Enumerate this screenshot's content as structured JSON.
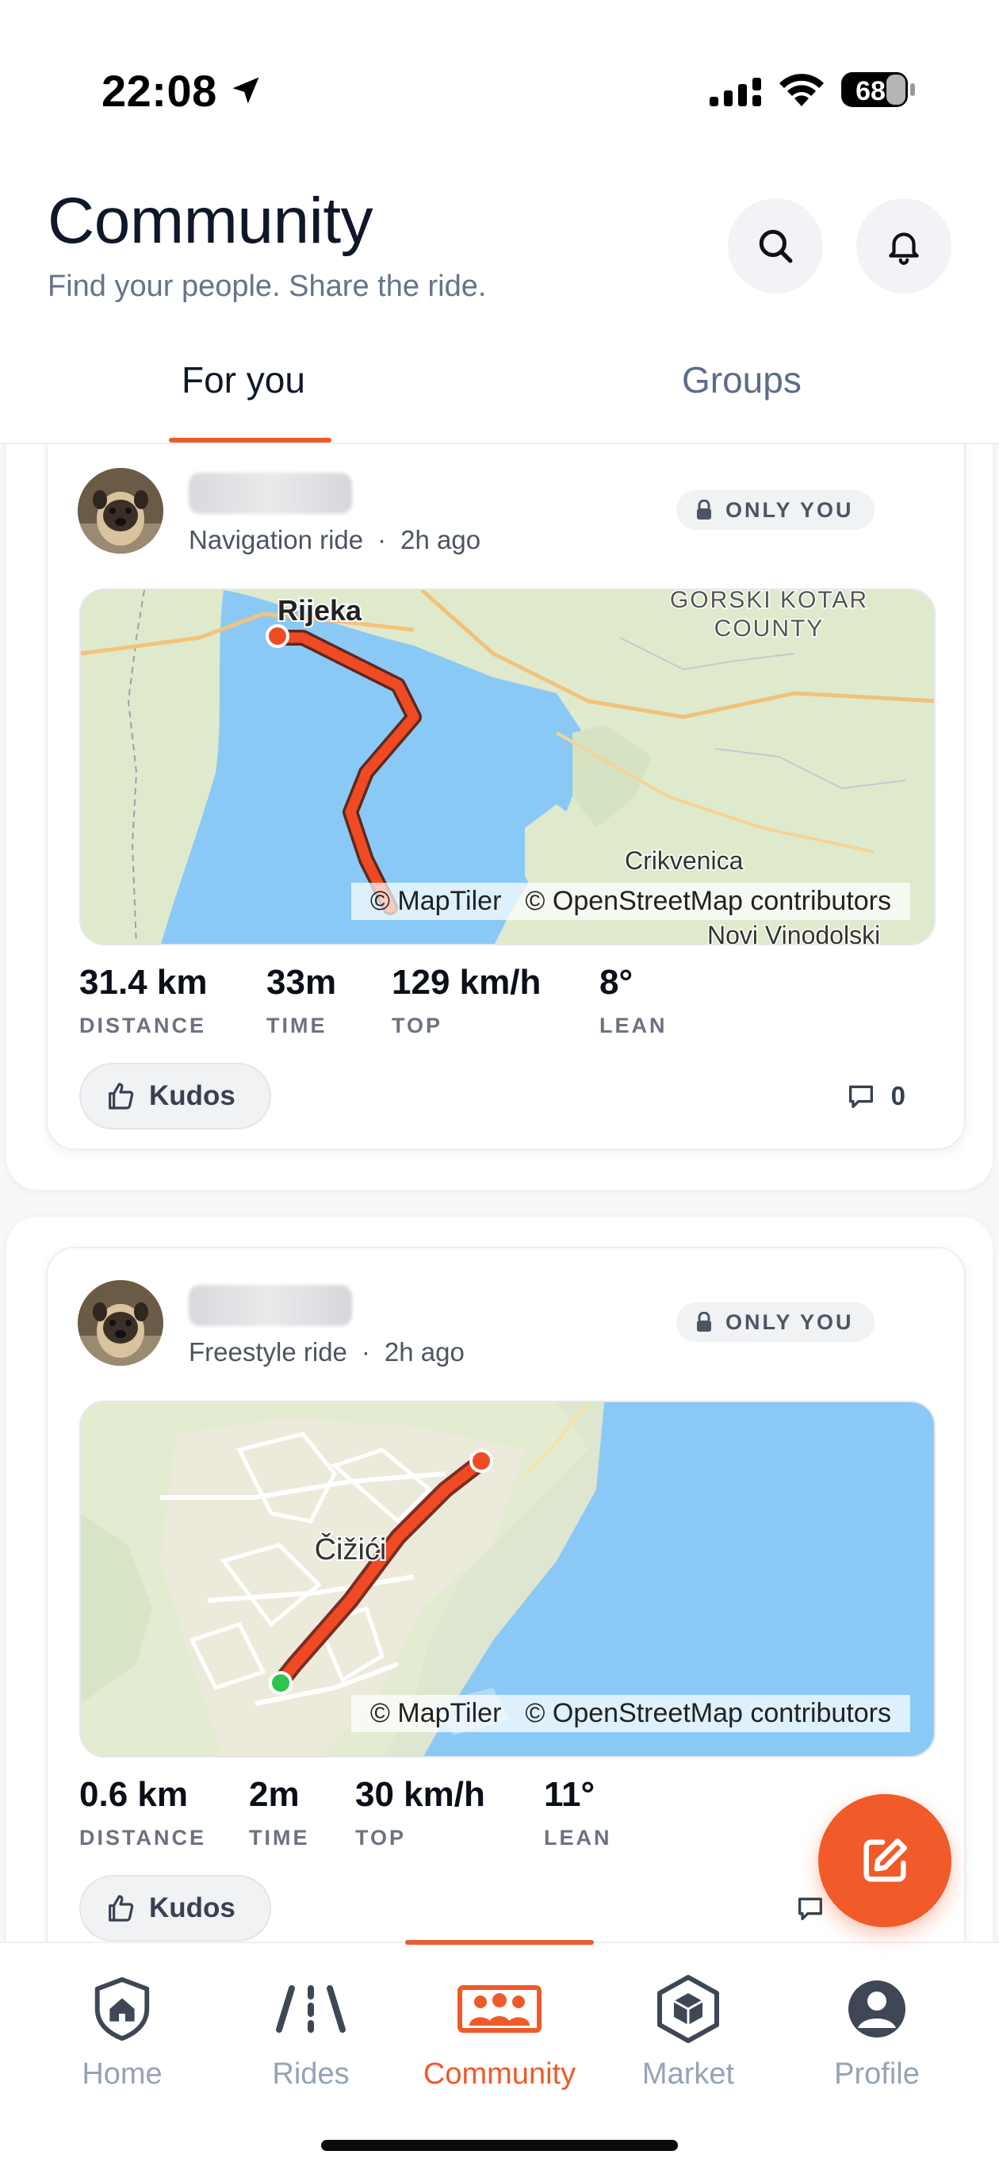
{
  "status": {
    "time": "22:08",
    "battery": "68"
  },
  "header": {
    "title": "Community",
    "subtitle": "Find your people. Share the ride."
  },
  "tabs": [
    {
      "label": "For you",
      "active": true
    },
    {
      "label": "Groups",
      "active": false
    }
  ],
  "posts": [
    {
      "ride_type": "Navigation ride",
      "time_ago": "2h ago",
      "privacy": "ONLY YOU",
      "map": {
        "labels": [
          "Rijeka",
          "GORSKI KOTAR",
          "COUNTY",
          "Crikvenica",
          "Novi Vinodolski"
        ],
        "attribution": [
          "© MapTiler",
          "© OpenStreetMap contributors"
        ]
      },
      "stats": [
        {
          "value": "31.4 km",
          "label": "DISTANCE"
        },
        {
          "value": "33m",
          "label": "TIME"
        },
        {
          "value": "129 km/h",
          "label": "TOP"
        },
        {
          "value": "8°",
          "label": "LEAN"
        }
      ],
      "kudos_label": "Kudos",
      "comment_count": "0"
    },
    {
      "ride_type": "Freestyle ride",
      "time_ago": "2h ago",
      "privacy": "ONLY YOU",
      "map": {
        "labels": [
          "Čižići"
        ],
        "attribution": [
          "© MapTiler",
          "© OpenStreetMap contributors"
        ]
      },
      "stats": [
        {
          "value": "0.6 km",
          "label": "DISTANCE"
        },
        {
          "value": "2m",
          "label": "TIME"
        },
        {
          "value": "30 km/h",
          "label": "TOP"
        },
        {
          "value": "11°",
          "label": "LEAN"
        }
      ],
      "kudos_label": "Kudos"
    }
  ],
  "nav": [
    {
      "label": "Home",
      "icon": "home-shield-icon",
      "active": false
    },
    {
      "label": "Rides",
      "icon": "road-icon",
      "active": false
    },
    {
      "label": "Community",
      "icon": "community-icon",
      "active": true
    },
    {
      "label": "Market",
      "icon": "market-box-icon",
      "active": false
    },
    {
      "label": "Profile",
      "icon": "profile-icon",
      "active": false
    }
  ],
  "colors": {
    "accent": "#EF5A2A",
    "water": "#8AC9F5",
    "land": "#DDE9CF",
    "route": "#F04A24"
  }
}
